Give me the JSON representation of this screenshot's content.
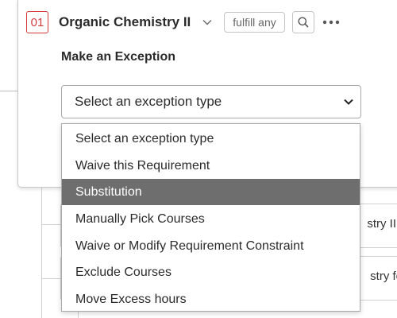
{
  "background": {
    "card1_text": "stry II",
    "card2_text": "stry fo"
  },
  "card": {
    "index": "01",
    "title": "Organic Chemistry II",
    "fulfill_label": "fulfill any",
    "chevron_icon": "chevron-down-icon",
    "search_icon": "search-icon",
    "more_icon": "more-horizontal-icon"
  },
  "exception": {
    "label": "Make an Exception",
    "select_value": "Select an exception type",
    "options": [
      "Select an exception type",
      "Waive this Requirement",
      "Substitution",
      "Manually Pick Courses",
      "Waive or Modify Requirement Constraint",
      "Exclude Courses",
      "Move Excess hours"
    ],
    "highlighted_option": "Substitution"
  },
  "colors": {
    "badge": "#d33b3b",
    "highlight": "#6e6e6e"
  }
}
